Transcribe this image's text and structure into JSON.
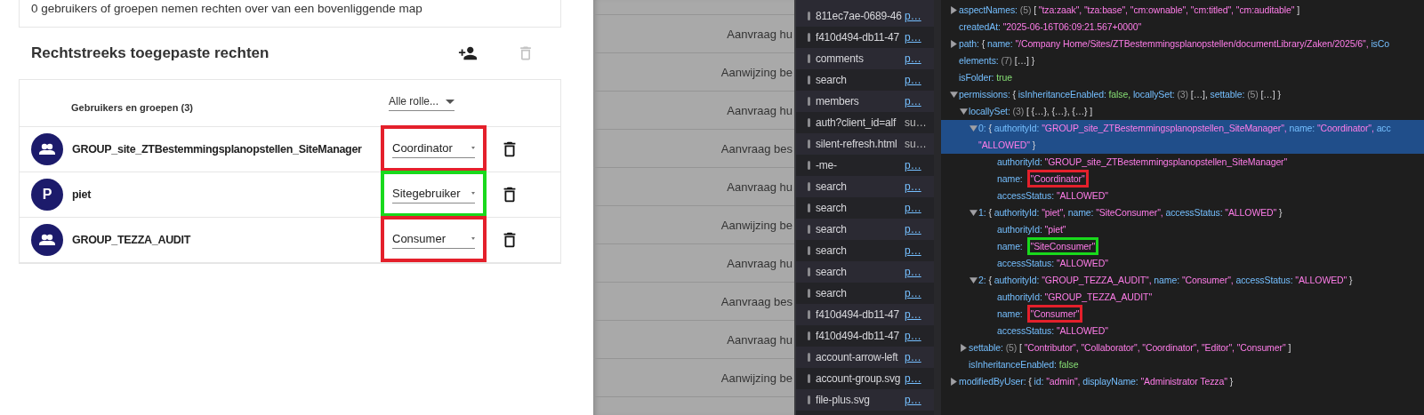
{
  "inherit_card": {
    "text": "0 gebruikers of groepen nemen rechten over van een bovenliggende map"
  },
  "direct_permissions": {
    "title": "Rechtstreeks toegepaste rechten",
    "delete_all_disabled": true,
    "header": {
      "label": "Gebruikers en groepen (3)",
      "filter": "Alle rolle..."
    },
    "rows": [
      {
        "name": "GROUP_site_ZTBestemmingsplanopstellen_SiteManager",
        "avatar": {
          "kind": "group"
        },
        "role": "Coordinator",
        "highlight": {
          "color": "#e4202b"
        }
      },
      {
        "name": "piet",
        "avatar": {
          "kind": "letter",
          "letter": "P"
        },
        "role": "Sitegebruiker",
        "highlight": {
          "color": "#19d91c"
        }
      },
      {
        "name": "GROUP_TEZZA_AUDIT",
        "avatar": {
          "kind": "group"
        },
        "role": "Consumer",
        "highlight": {
          "color": "#e4202b"
        }
      }
    ]
  },
  "background_list": [
    "Aanvraag hu",
    "Aanwijzing be",
    "Aanvraag hu",
    "Aanvraag bes",
    "Aanvraag hu",
    "Aanwijzing be",
    "Aanvraag hu",
    "Aanvraag bes",
    "Aanvraag hu",
    "Aanwijzing be"
  ],
  "network_requests": [
    {
      "name": "811ec7ae-0689-46",
      "column_2": "p…"
    },
    {
      "name": "f410d494-db11-47",
      "column_2": "p…"
    },
    {
      "name": "comments",
      "column_2": "p…"
    },
    {
      "name": "search",
      "column_2": "p…"
    },
    {
      "name": "members",
      "column_2": "p…"
    },
    {
      "name": "auth?client_id=alf",
      "column_2": "su…"
    },
    {
      "name": "silent-refresh.html",
      "column_2": "su…"
    },
    {
      "name": "-me-",
      "column_2": "p…"
    },
    {
      "name": "search",
      "column_2": "p…"
    },
    {
      "name": "search",
      "column_2": "p…"
    },
    {
      "name": "search",
      "column_2": "p…"
    },
    {
      "name": "search",
      "column_2": "p…"
    },
    {
      "name": "search",
      "column_2": "p…"
    },
    {
      "name": "search",
      "column_2": "p…"
    },
    {
      "name": "f410d494-db11-47",
      "column_2": "p…"
    },
    {
      "name": "f410d494-db11-47",
      "column_2": "p…"
    },
    {
      "name": "account-arrow-left",
      "column_2": "p…"
    },
    {
      "name": "account-group.svg",
      "column_2": "p…"
    },
    {
      "name": "file-plus.svg",
      "column_2": "p…"
    }
  ],
  "inspector": [
    {
      "expanded": false,
      "selected": false,
      "segments": [
        {
          "kind": "key",
          "text": "aspectNames:"
        },
        {
          "kind": "count",
          "text": "(5)"
        },
        {
          "kind": "punct",
          "text": "["
        },
        {
          "kind": "string",
          "text": "\"tza:zaak\", \"tza:base\", \"cm:ownable\", \"cm:titled\", \"cm:auditable\""
        },
        {
          "kind": "punct",
          "text": "]"
        }
      ]
    },
    {
      "selected": false,
      "segments": [
        {
          "kind": "key",
          "text": "createdAt:"
        },
        {
          "kind": "string",
          "text": "\"2025-06-16T06:09:21.567+0000\""
        }
      ]
    },
    {
      "expanded": false,
      "selected": false,
      "segments": [
        {
          "kind": "key",
          "text": "path:"
        },
        {
          "kind": "punct",
          "text": "{"
        },
        {
          "kind": "key",
          "text": "name:"
        },
        {
          "kind": "string",
          "text": "\"/Company Home/Sites/ZTBestemmingsplanopstellen/documentLibrary/Zaken/2025/6\","
        },
        {
          "kind": "key",
          "text": "isCo"
        }
      ],
      "continuation": [
        {
          "kind": "key",
          "text": "elements:"
        },
        {
          "kind": "count",
          "text": "(7)"
        },
        {
          "kind": "punct",
          "text": "[…] }"
        }
      ]
    },
    {
      "selected": false,
      "segments": [
        {
          "kind": "key",
          "text": "isFolder:"
        },
        {
          "kind": "bool",
          "text": "true"
        }
      ]
    },
    {
      "expanded": true,
      "selected": false,
      "segments": [
        {
          "kind": "key",
          "text": "permissions:"
        },
        {
          "kind": "punct",
          "text": "{"
        },
        {
          "kind": "key",
          "text": "isInheritanceEnabled:"
        },
        {
          "kind": "bool",
          "text": "false,"
        },
        {
          "kind": "key",
          "text": "locallySet:"
        },
        {
          "kind": "count",
          "text": "(3)"
        },
        {
          "kind": "punct",
          "text": "[…],"
        },
        {
          "kind": "key",
          "text": "settable:"
        },
        {
          "kind": "count",
          "text": "(5)"
        },
        {
          "kind": "punct",
          "text": "[…] }"
        }
      ],
      "children": [
        {
          "expanded": true,
          "selected": false,
          "segments": [
            {
              "kind": "key",
              "text": "locallySet:"
            },
            {
              "kind": "count",
              "text": "(3)"
            },
            {
              "kind": "punct",
              "text": "[ {…}, {…}, {…} ]"
            }
          ],
          "children": [
            {
              "expanded": true,
              "selected": true,
              "segments": [
                {
                  "kind": "key",
                  "text": "0:"
                },
                {
                  "kind": "punct",
                  "text": "{"
                },
                {
                  "kind": "key",
                  "text": "authorityId:"
                },
                {
                  "kind": "string",
                  "text": "\"GROUP_site_ZTBestemmingsplanopstellen_SiteManager\","
                },
                {
                  "kind": "key",
                  "text": "name:"
                },
                {
                  "kind": "string",
                  "text": "\"Coordinator\","
                },
                {
                  "kind": "key",
                  "text": "acc"
                }
              ],
              "continuation": [
                {
                  "kind": "string",
                  "text": "\"ALLOWED\""
                },
                {
                  "kind": "punct",
                  "text": "}"
                }
              ],
              "children": [
                {
                  "selected": false,
                  "segments": [
                    {
                      "kind": "key",
                      "text": "authorityId:"
                    },
                    {
                      "kind": "string",
                      "text": "\"GROUP_site_ZTBestemmingsplanopstellen_SiteManager\""
                    }
                  ]
                },
                {
                  "selected": false,
                  "segments": [
                    {
                      "kind": "key",
                      "text": "name:"
                    },
                    {
                      "kind": "string",
                      "text": "\"Coordinator\"",
                      "highlight": {
                        "color": "#e4202b"
                      }
                    }
                  ]
                },
                {
                  "selected": false,
                  "segments": [
                    {
                      "kind": "key",
                      "text": "accessStatus:"
                    },
                    {
                      "kind": "string",
                      "text": "\"ALLOWED\""
                    }
                  ]
                }
              ]
            },
            {
              "expanded": true,
              "selected": false,
              "segments": [
                {
                  "kind": "key",
                  "text": "1:"
                },
                {
                  "kind": "punct",
                  "text": "{"
                },
                {
                  "kind": "key",
                  "text": "authorityId:"
                },
                {
                  "kind": "string",
                  "text": "\"piet\","
                },
                {
                  "kind": "key",
                  "text": "name:"
                },
                {
                  "kind": "string",
                  "text": "\"SiteConsumer\","
                },
                {
                  "kind": "key",
                  "text": "accessStatus:"
                },
                {
                  "kind": "string",
                  "text": "\"ALLOWED\""
                },
                {
                  "kind": "punct",
                  "text": "}"
                }
              ],
              "children": [
                {
                  "selected": false,
                  "segments": [
                    {
                      "kind": "key",
                      "text": "authorityId:"
                    },
                    {
                      "kind": "string",
                      "text": "\"piet\""
                    }
                  ]
                },
                {
                  "selected": false,
                  "segments": [
                    {
                      "kind": "key",
                      "text": "name:"
                    },
                    {
                      "kind": "string",
                      "text": "\"SiteConsumer\"",
                      "highlight": {
                        "color": "#19d91c"
                      }
                    }
                  ]
                },
                {
                  "selected": false,
                  "segments": [
                    {
                      "kind": "key",
                      "text": "accessStatus:"
                    },
                    {
                      "kind": "string",
                      "text": "\"ALLOWED\""
                    }
                  ]
                }
              ]
            },
            {
              "expanded": true,
              "selected": false,
              "segments": [
                {
                  "kind": "key",
                  "text": "2:"
                },
                {
                  "kind": "punct",
                  "text": "{"
                },
                {
                  "kind": "key",
                  "text": "authorityId:"
                },
                {
                  "kind": "string",
                  "text": "\"GROUP_TEZZA_AUDIT\","
                },
                {
                  "kind": "key",
                  "text": "name:"
                },
                {
                  "kind": "string",
                  "text": "\"Consumer\","
                },
                {
                  "kind": "key",
                  "text": "accessStatus:"
                },
                {
                  "kind": "string",
                  "text": "\"ALLOWED\""
                },
                {
                  "kind": "punct",
                  "text": "}"
                }
              ],
              "children": [
                {
                  "selected": false,
                  "segments": [
                    {
                      "kind": "key",
                      "text": "authorityId:"
                    },
                    {
                      "kind": "string",
                      "text": "\"GROUP_TEZZA_AUDIT\""
                    }
                  ]
                },
                {
                  "selected": false,
                  "segments": [
                    {
                      "kind": "key",
                      "text": "name:"
                    },
                    {
                      "kind": "string",
                      "text": "\"Consumer\"",
                      "highlight": {
                        "color": "#e4202b"
                      }
                    }
                  ]
                },
                {
                  "selected": false,
                  "segments": [
                    {
                      "kind": "key",
                      "text": "accessStatus:"
                    },
                    {
                      "kind": "string",
                      "text": "\"ALLOWED\""
                    }
                  ]
                }
              ]
            }
          ]
        },
        {
          "expanded": false,
          "selected": false,
          "segments": [
            {
              "kind": "key",
              "text": "settable:"
            },
            {
              "kind": "count",
              "text": "(5)"
            },
            {
              "kind": "punct",
              "text": "["
            },
            {
              "kind": "string",
              "text": "\"Contributor\", \"Collaborator\", \"Coordinator\", \"Editor\", \"Consumer\""
            },
            {
              "kind": "punct",
              "text": "]"
            }
          ]
        },
        {
          "selected": false,
          "segments": [
            {
              "kind": "key",
              "text": "isInheritanceEnabled:"
            },
            {
              "kind": "bool",
              "text": "false"
            }
          ]
        }
      ]
    },
    {
      "expanded": false,
      "selected": false,
      "segments": [
        {
          "kind": "key",
          "text": "modifiedByUser:"
        },
        {
          "kind": "punct",
          "text": "{"
        },
        {
          "kind": "key",
          "text": "id:"
        },
        {
          "kind": "string",
          "text": "\"admin\","
        },
        {
          "kind": "key",
          "text": "displayName:"
        },
        {
          "kind": "string",
          "text": "\"Administrator Tezza\""
        },
        {
          "kind": "punct",
          "text": "}"
        }
      ]
    }
  ]
}
